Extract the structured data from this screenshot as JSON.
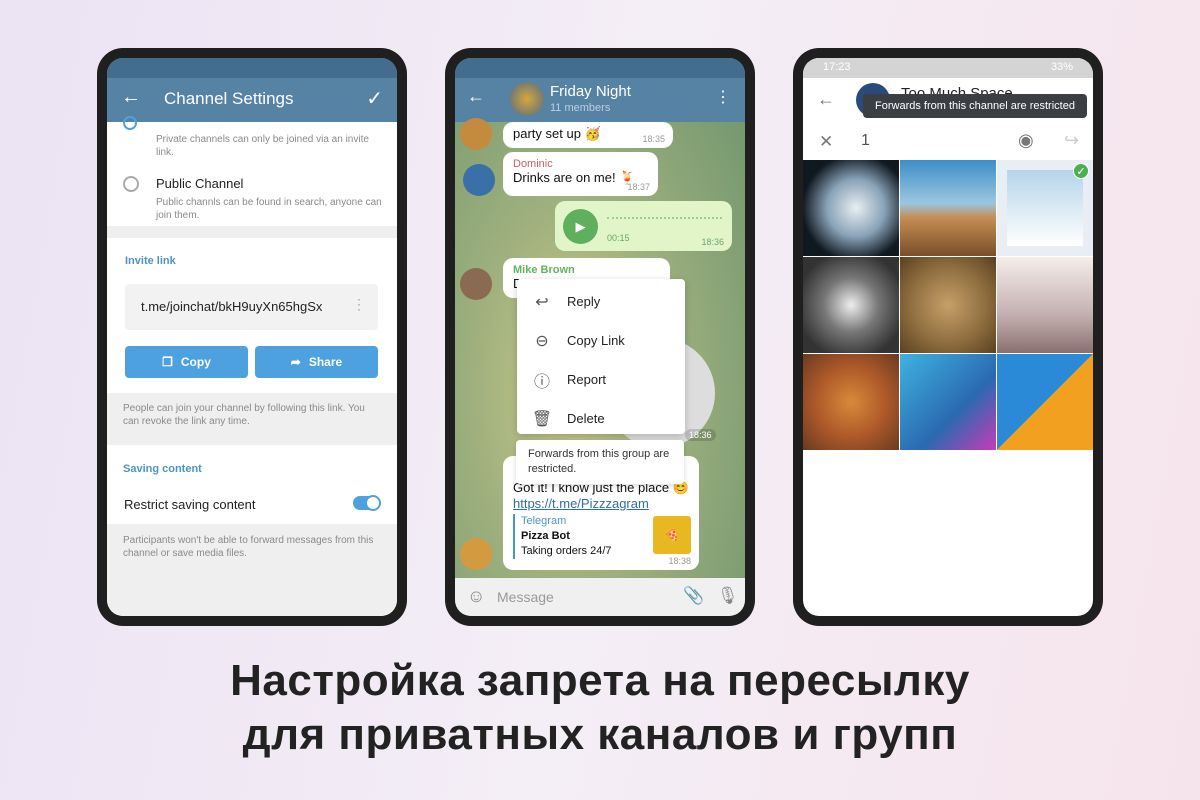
{
  "headline": {
    "line1": "Настройка запрета на пересылку",
    "line2": "для приватных каналов и групп"
  },
  "phone1": {
    "title": "Channel Settings",
    "private_desc": "Private channels can only be joined via an invite link.",
    "public_label": "Public Channel",
    "public_desc": "Public channls can be found in search, anyone can join them.",
    "invite_header": "Invite link",
    "invite_link": "t.me/joinchat/bkH9uyXn65hgSx",
    "copy": "Copy",
    "share": "Share",
    "invite_note": "People can join your channel by following this link. You can revoke the link any time.",
    "saving_header": "Saving content",
    "restrict_label": "Restrict saving content",
    "restrict_on": true,
    "restrict_note": "Participants won't be able to forward messages from this channel or save media files.",
    "accent": "#5682a3"
  },
  "phone2": {
    "title": "Friday Night",
    "subtitle": "11 members",
    "messages": [
      {
        "text": "party set up 🥳",
        "time": "18:35"
      },
      {
        "sender": "Dominic",
        "text": "Drinks are on me! 🍹",
        "time": "18:37"
      },
      {
        "voice_duration": "00:15",
        "time": "18:36"
      },
      {
        "sender": "Mike Brown",
        "text": "D"
      },
      {
        "sticker_time": "18:36"
      },
      {
        "text": "Got it! I know just the place 😊",
        "link": "https://t.me/Pizzzagram",
        "preview_site": "Telegram",
        "preview_title": "Pizza Bot",
        "preview_desc": "Taking orders 24/7",
        "time": "18:38"
      }
    ],
    "menu": [
      "Reply",
      "Copy Link",
      "Report",
      "Delete"
    ],
    "tooltip": "Forwards from this group are restricted.",
    "input_placeholder": "Message"
  },
  "phone3": {
    "status_time": "17:23",
    "battery": "33%",
    "title": "Too Much Space",
    "tooltip": "Forwards from this channel are restricted",
    "selected_count": "1"
  }
}
